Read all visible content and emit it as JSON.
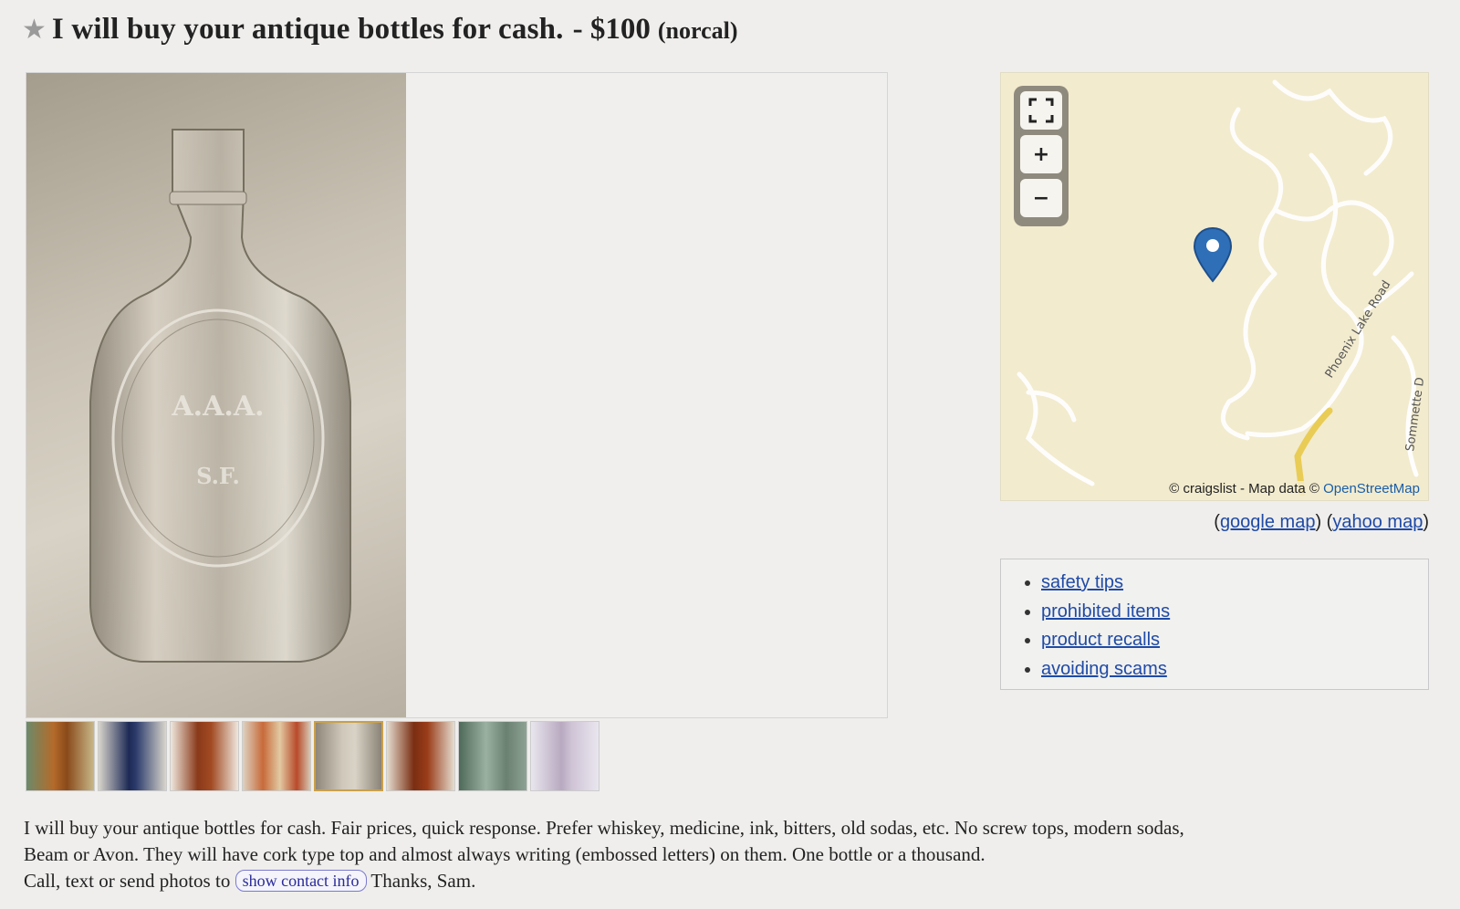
{
  "posting": {
    "star_icon": "star-icon",
    "title": "I will buy your antique bottles for cash.",
    "price": "- $100",
    "location": "(norcal)"
  },
  "gallery": {
    "main_image": "antique-bottle-photo",
    "embossed_text": [
      "A.A.A.",
      "S.F."
    ],
    "thumbnail_count": 8,
    "selected_thumbnail": 5
  },
  "map": {
    "fullscreen_icon": "fullscreen-icon",
    "zoom_in_label": "+",
    "zoom_out_label": "−",
    "road_label_1": "Phoenix Lake Road",
    "road_label_2": "Sommette D",
    "attribution_prefix": "© craigslist - Map data ©",
    "attribution_link": "OpenStreetMap",
    "google_link": "google map",
    "yahoo_link": "yahoo map"
  },
  "tips": {
    "items": [
      "safety tips",
      "prohibited items",
      "product recalls",
      "avoiding scams"
    ]
  },
  "body": {
    "line1": "I will buy your antique bottles for cash. Fair prices, quick response. Prefer whiskey, medicine, ink, bitters, old sodas, etc. No screw tops, modern sodas,",
    "line2": "Beam or Avon. They will have cork type top and almost always writing (embossed letters) on them. One bottle or a thousand.",
    "line3_prefix": "Call, text or send photos to",
    "contact_button": "show contact info",
    "line3_suffix": "Thanks, Sam."
  },
  "colors": {
    "link": "#1f4aa6",
    "map_bg": "#f2ebce",
    "map_pin": "#2f6fb7",
    "selected_thumb_border": "#c9a04a"
  }
}
